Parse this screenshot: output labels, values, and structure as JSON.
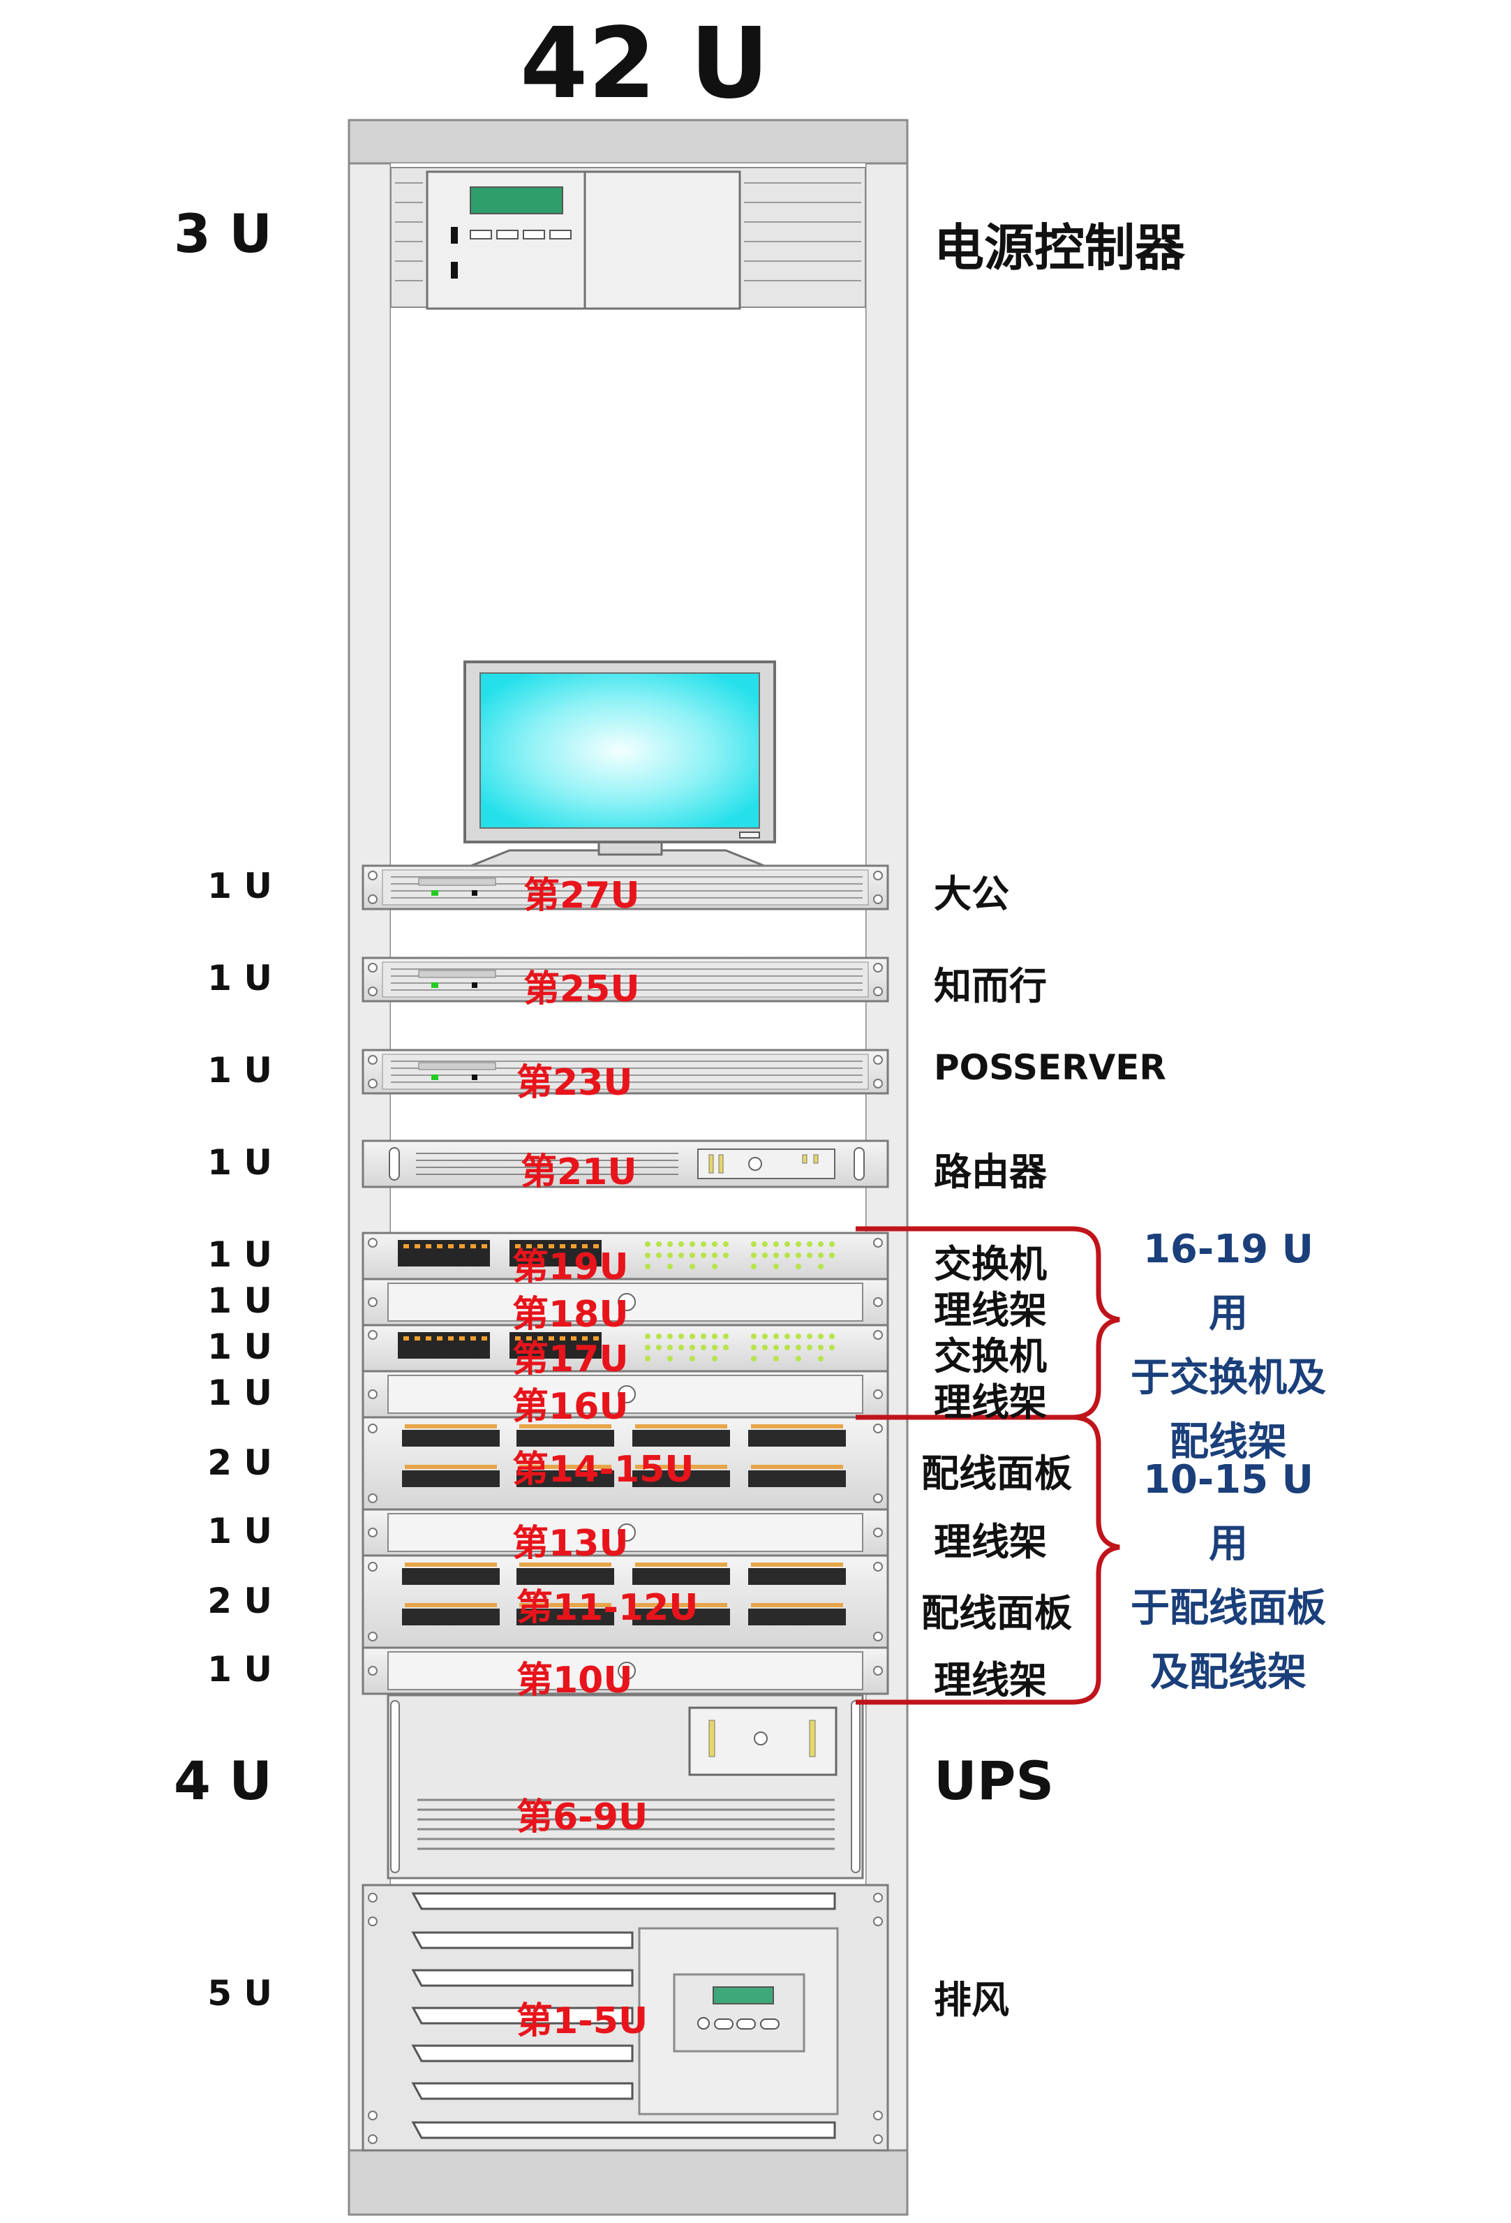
{
  "title": "42 U",
  "rack_rows": [
    {
      "id": "power",
      "u_label": "3 U",
      "slot": "",
      "device": "电源控制器"
    },
    {
      "id": "srv-27",
      "u_label": "1 U",
      "slot": "第27U",
      "device": "大公"
    },
    {
      "id": "srv-25",
      "u_label": "1 U",
      "slot": "第25U",
      "device": "知而行"
    },
    {
      "id": "srv-23",
      "u_label": "1 U",
      "slot": "第23U",
      "device": "POSSERVER"
    },
    {
      "id": "router-21",
      "u_label": "1 U",
      "slot": "第21U",
      "device": "路由器"
    },
    {
      "id": "switch-19",
      "u_label": "1 U",
      "slot": "第19U",
      "device": "交换机"
    },
    {
      "id": "cable-18",
      "u_label": "1 U",
      "slot": "第18U",
      "device": "理线架"
    },
    {
      "id": "switch-17",
      "u_label": "1 U",
      "slot": "第17U",
      "device": "交换机"
    },
    {
      "id": "cable-16",
      "u_label": "1 U",
      "slot": "第16U",
      "device": "理线架"
    },
    {
      "id": "patch-14-15",
      "u_label": "2 U",
      "slot": "第14-15U",
      "device": "配线面板"
    },
    {
      "id": "cable-13",
      "u_label": "1 U",
      "slot": "第13U",
      "device": "理线架"
    },
    {
      "id": "patch-11-12",
      "u_label": "2 U",
      "slot": "第11-12U",
      "device": "配线面板"
    },
    {
      "id": "cable-10",
      "u_label": "1 U",
      "slot": "第10U",
      "device": "理线架"
    },
    {
      "id": "ups",
      "u_label": "4 U",
      "slot": "第6-9U",
      "device": "UPS"
    },
    {
      "id": "fan",
      "u_label": "5 U",
      "slot": "第1-5U",
      "device": "排风"
    }
  ],
  "group_notes": {
    "upper": [
      "16-19 U用",
      "于交换机及",
      "配线架"
    ],
    "lower": [
      "10-15 U用",
      "于配线面板",
      "及配线架"
    ]
  },
  "colors": {
    "slot_text": "#e8141b",
    "bracket": "#c0141b",
    "note_text": "#1a3f7a",
    "rack_frame": "#d9d9d9",
    "monitor_screen": "#3fe6ef"
  }
}
